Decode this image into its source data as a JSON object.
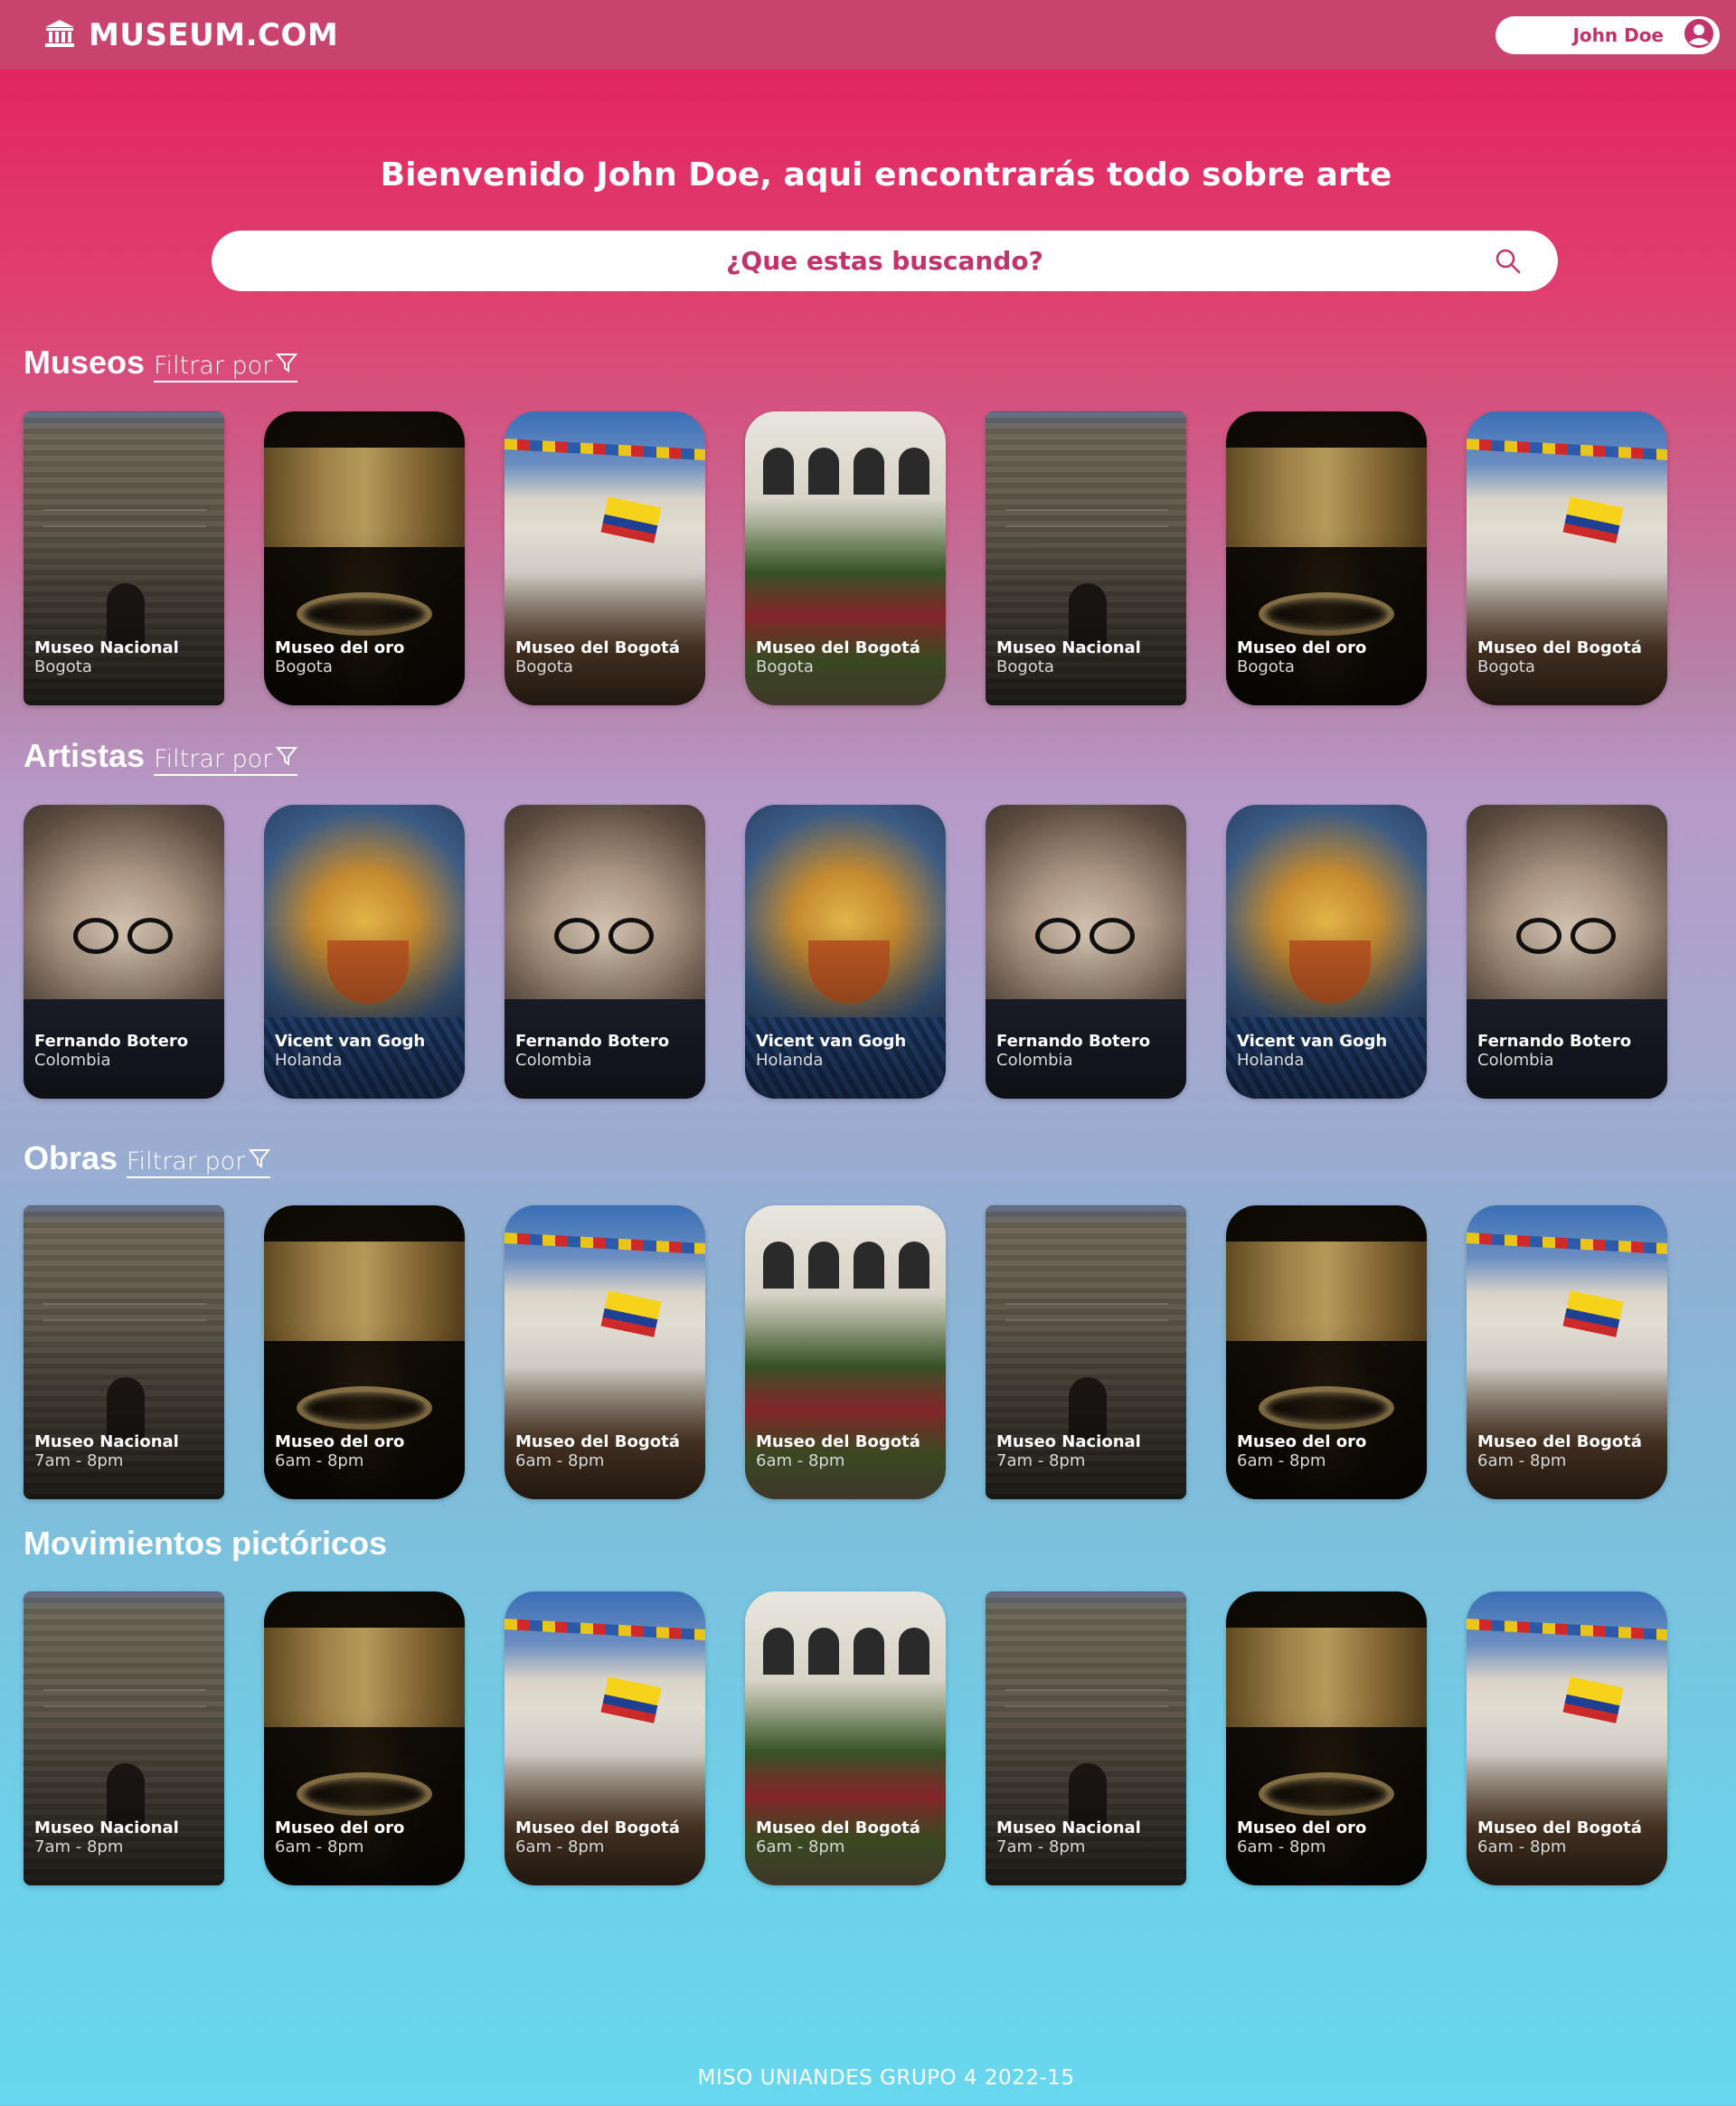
{
  "header": {
    "brand": "MUSEUM.COM",
    "user_name": "John Doe"
  },
  "welcome": "Bienvenido John Doe, aqui encontrarás todo sobre arte",
  "search": {
    "placeholder": "¿Que estas buscando?"
  },
  "filter_label": "Filtrar por",
  "sections": {
    "museos": {
      "title": "Museos",
      "cards": [
        {
          "title": "Museo Nacional",
          "subtitle": "Bogota",
          "image": "museo-nacional"
        },
        {
          "title": "Museo del oro",
          "subtitle": "Bogota",
          "image": "museo-del-oro"
        },
        {
          "title": "Museo del Bogotá",
          "subtitle": "Bogota",
          "image": "museo-de-bogota"
        },
        {
          "title": "Museo del Bogotá",
          "subtitle": "Bogota",
          "image": "museo-patio"
        },
        {
          "title": "Museo Nacional",
          "subtitle": "Bogota",
          "image": "museo-nacional"
        },
        {
          "title": "Museo del oro",
          "subtitle": "Bogota",
          "image": "museo-del-oro"
        },
        {
          "title": "Museo del Bogotá",
          "subtitle": "Bogota",
          "image": "museo-de-bogota"
        }
      ]
    },
    "artistas": {
      "title": "Artistas",
      "cards": [
        {
          "title": "Fernando Botero",
          "subtitle": "Colombia",
          "image": "botero"
        },
        {
          "title": "Vicent van Gogh",
          "subtitle": "Holanda",
          "image": "van-gogh"
        },
        {
          "title": "Fernando Botero",
          "subtitle": "Colombia",
          "image": "botero"
        },
        {
          "title": "Vicent van Gogh",
          "subtitle": "Holanda",
          "image": "van-gogh"
        },
        {
          "title": "Fernando Botero",
          "subtitle": "Colombia",
          "image": "botero"
        },
        {
          "title": "Vicent van Gogh",
          "subtitle": "Holanda",
          "image": "van-gogh"
        },
        {
          "title": "Fernando Botero",
          "subtitle": "Colombia",
          "image": "botero"
        }
      ]
    },
    "obras": {
      "title": "Obras",
      "cards": [
        {
          "title": "Museo Nacional",
          "subtitle": "7am - 8pm",
          "image": "museo-nacional"
        },
        {
          "title": "Museo del oro",
          "subtitle": "6am - 8pm",
          "image": "museo-del-oro"
        },
        {
          "title": "Museo del Bogotá",
          "subtitle": "6am - 8pm",
          "image": "museo-de-bogota"
        },
        {
          "title": "Museo del Bogotá",
          "subtitle": "6am - 8pm",
          "image": "museo-patio"
        },
        {
          "title": "Museo Nacional",
          "subtitle": "7am - 8pm",
          "image": "museo-nacional"
        },
        {
          "title": "Museo del oro",
          "subtitle": "6am - 8pm",
          "image": "museo-del-oro"
        },
        {
          "title": "Museo del Bogotá",
          "subtitle": "6am - 8pm",
          "image": "museo-de-bogota"
        }
      ]
    },
    "movimientos": {
      "title": "Movimientos pictóricos",
      "cards": [
        {
          "title": "Museo Nacional",
          "subtitle": "7am - 8pm",
          "image": "museo-nacional"
        },
        {
          "title": "Museo del oro",
          "subtitle": "6am - 8pm",
          "image": "museo-del-oro"
        },
        {
          "title": "Museo del Bogotá",
          "subtitle": "6am - 8pm",
          "image": "museo-de-bogota"
        },
        {
          "title": "Museo del Bogotá",
          "subtitle": "6am - 8pm",
          "image": "museo-patio"
        },
        {
          "title": "Museo Nacional",
          "subtitle": "7am - 8pm",
          "image": "museo-nacional"
        },
        {
          "title": "Museo del oro",
          "subtitle": "6am - 8pm",
          "image": "museo-del-oro"
        },
        {
          "title": "Museo del Bogotá",
          "subtitle": "6am - 8pm",
          "image": "museo-de-bogota"
        }
      ]
    }
  },
  "footer": "MISO UNIANDES GRUPO 4 2022-15",
  "colors": {
    "header": "#c8446e",
    "accent": "#c2336a",
    "gradient_top": "#e31d5e",
    "gradient_bottom": "#67d8ef"
  }
}
